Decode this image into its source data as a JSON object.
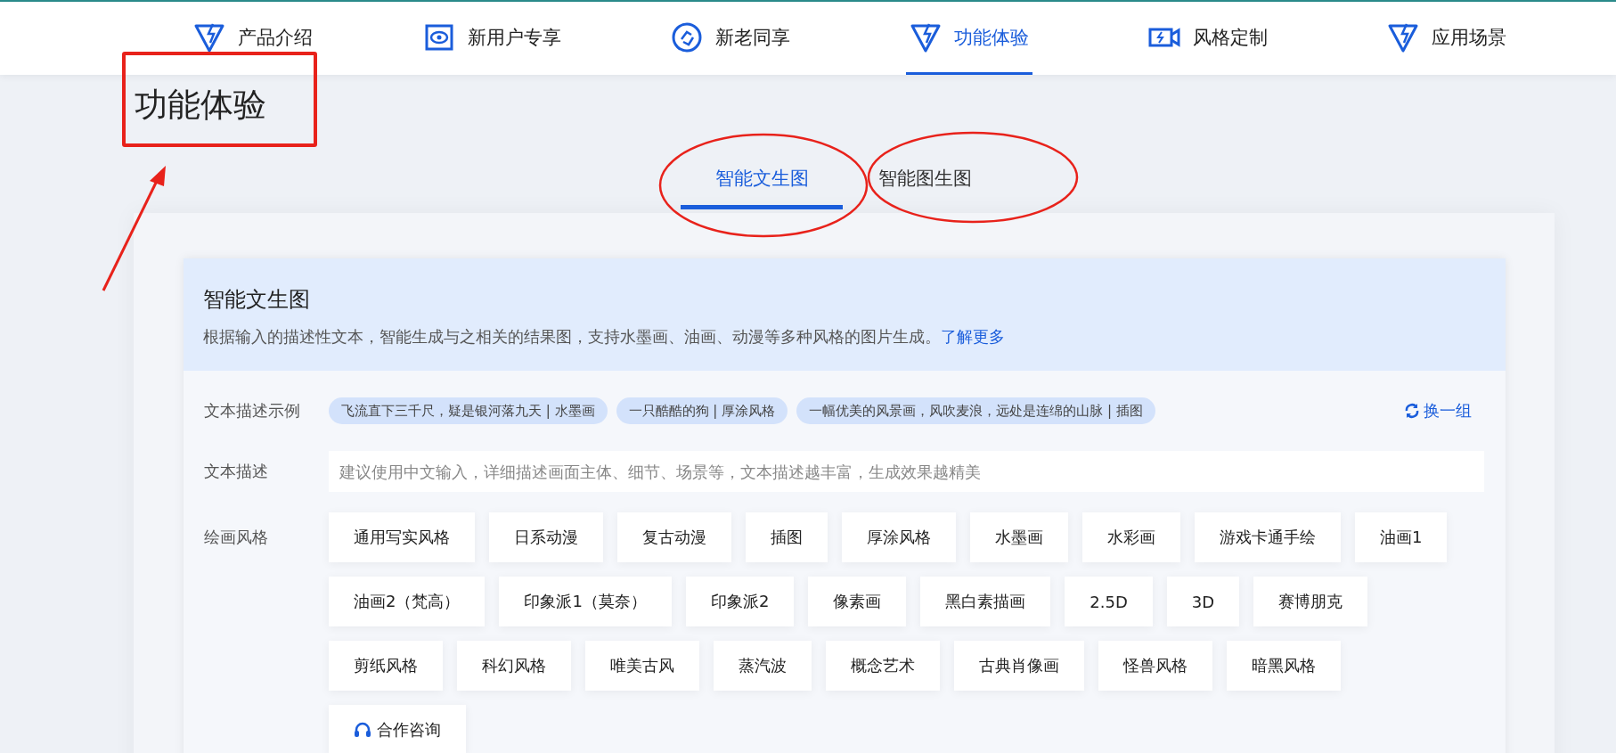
{
  "nav": [
    {
      "label": "产品介绍",
      "selected": false
    },
    {
      "label": "新用户专享",
      "selected": false
    },
    {
      "label": "新老同享",
      "selected": false
    },
    {
      "label": "功能体验",
      "selected": true
    },
    {
      "label": "风格定制",
      "selected": false
    },
    {
      "label": "应用场景",
      "selected": false
    }
  ],
  "page_title": "功能体验",
  "tabs": [
    {
      "label": "智能文生图",
      "selected": true
    },
    {
      "label": "智能图生图",
      "selected": false
    }
  ],
  "card": {
    "title": "智能文生图",
    "description": "根据输入的描述性文本，智能生成与之相关的结果图，支持水墨画、油画、动漫等多种风格的图片生成。",
    "learn_more": "了解更多"
  },
  "examples": {
    "label": "文本描述示例",
    "items": [
      "飞流直下三千尺，疑是银河落九天 | 水墨画",
      "一只酷酷的狗 | 厚涂风格",
      "一幅优美的风景画，风吹麦浪，远处是连绵的山脉 | 插图"
    ],
    "refresh": "换一组"
  },
  "description_field": {
    "label": "文本描述",
    "placeholder": "建议使用中文输入，详细描述画面主体、细节、场景等，文本描述越丰富，生成效果越精美"
  },
  "styles": {
    "label": "绘画风格",
    "items": [
      "通用写实风格",
      "日系动漫",
      "复古动漫",
      "插图",
      "厚涂风格",
      "水墨画",
      "水彩画",
      "游戏卡通手绘",
      "油画1",
      "油画2（梵高）",
      "印象派1（莫奈）",
      "印象派2",
      "像素画",
      "黑白素描画",
      "2.5D",
      "3D",
      "赛博朋克",
      "剪纸风格",
      "科幻风格",
      "唯美古风",
      "蒸汽波",
      "概念艺术",
      "古典肖像画",
      "怪兽风格",
      "暗黑风格"
    ],
    "consult": "合作咨询"
  }
}
